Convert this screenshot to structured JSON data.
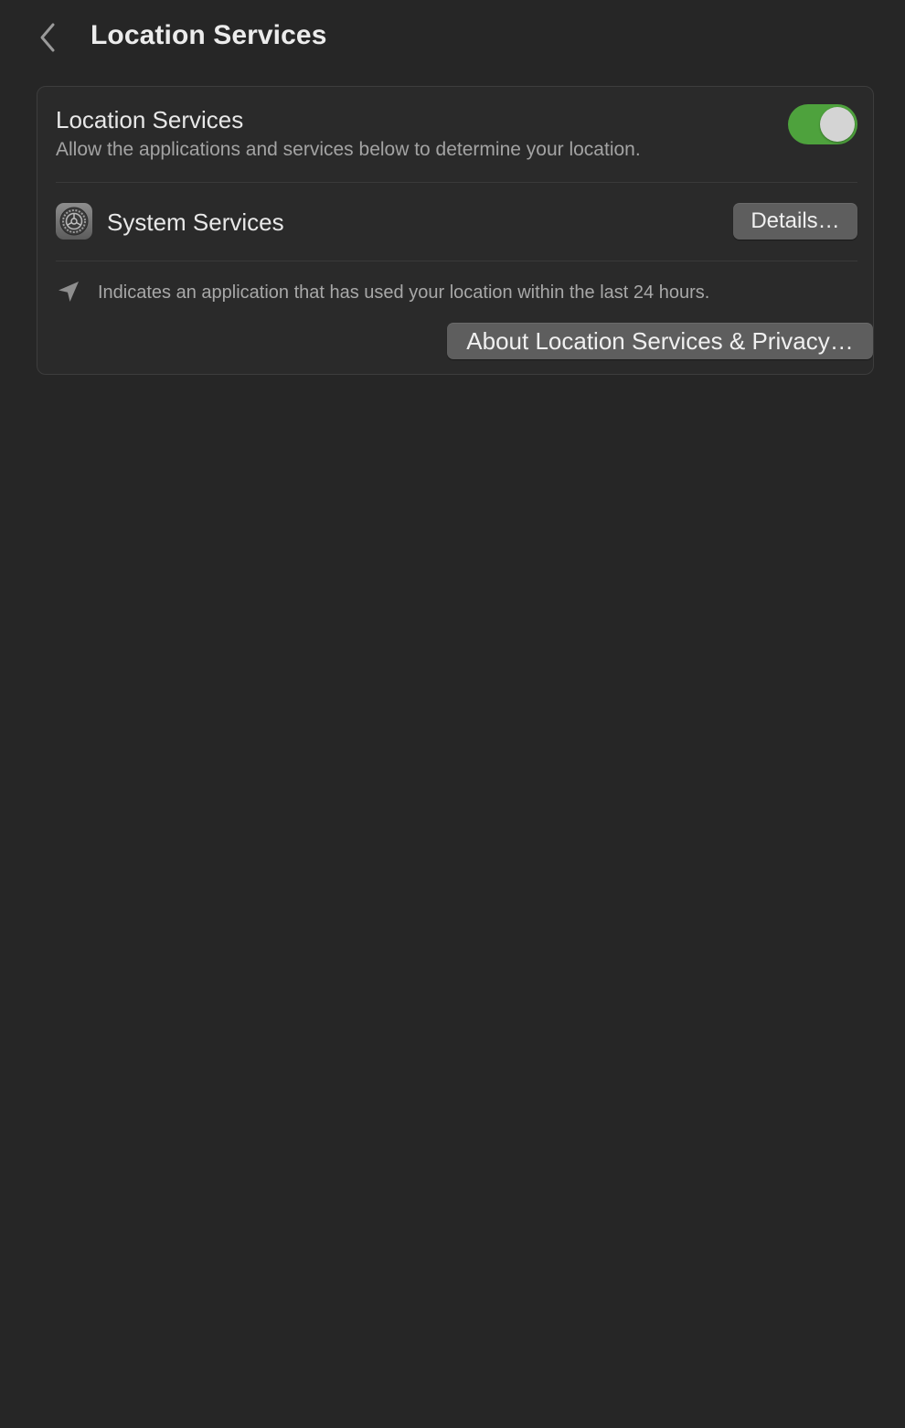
{
  "header": {
    "back_icon": "chevron-left-icon",
    "title": "Location Services"
  },
  "location_services": {
    "label": "Location Services",
    "description": "Allow the applications and services below to determine your location.",
    "toggle_on": true,
    "toggle_color": "#4ea23d"
  },
  "system_services": {
    "icon": "system-settings-gear-icon",
    "label": "System Services",
    "details_button": "Details…"
  },
  "note": {
    "icon": "location-arrow-icon",
    "text": "Indicates an application that has used your location within the last 24 hours."
  },
  "about_button": "About Location Services & Privacy…"
}
